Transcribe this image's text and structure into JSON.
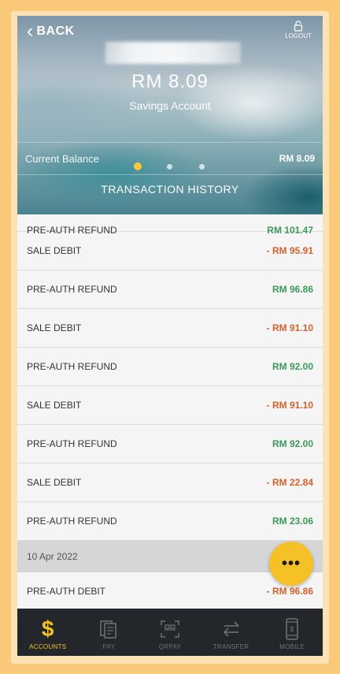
{
  "header": {
    "back_label": "BACK",
    "logout_label": "LOGOUT",
    "balance_display": "RM 8.09",
    "account_type": "Savings Account",
    "current_balance_label": "Current Balance",
    "current_balance_value": "RM 8.09",
    "section_title": "TRANSACTION HISTORY",
    "carousel": {
      "pages": 3,
      "active_index": 0
    }
  },
  "transactions": [
    {
      "desc": "PRE-AUTH REFUND",
      "amount": "RM 101.47",
      "type": "credit",
      "partial": true
    },
    {
      "desc": "SALE DEBIT",
      "amount": "- RM 95.91",
      "type": "debit"
    },
    {
      "desc": "PRE-AUTH REFUND",
      "amount": "RM 96.86",
      "type": "credit"
    },
    {
      "desc": "SALE DEBIT",
      "amount": "- RM 91.10",
      "type": "debit"
    },
    {
      "desc": "PRE-AUTH REFUND",
      "amount": "RM 92.00",
      "type": "credit"
    },
    {
      "desc": "SALE DEBIT",
      "amount": "- RM 91.10",
      "type": "debit"
    },
    {
      "desc": "PRE-AUTH REFUND",
      "amount": "RM 92.00",
      "type": "credit"
    },
    {
      "desc": "SALE DEBIT",
      "amount": "- RM 22.84",
      "type": "debit"
    },
    {
      "desc": "PRE-AUTH REFUND",
      "amount": "RM 23.06",
      "type": "credit"
    }
  ],
  "date_group": {
    "date": "10 Apr 2022",
    "transactions": [
      {
        "desc": "PRE-AUTH DEBIT",
        "amount": "- RM 96.86",
        "type": "debit"
      }
    ]
  },
  "fab": {
    "label": "•••",
    "icon": "more-dots-icon"
  },
  "nav": {
    "items": [
      {
        "label": "ACCOUNTS",
        "icon": "dollar-icon",
        "active": true
      },
      {
        "label": "PAY",
        "icon": "bill-icon",
        "active": false
      },
      {
        "label": "QRPAY",
        "icon": "qr-icon",
        "active": false
      },
      {
        "label": "TRANSFER",
        "icon": "transfer-arrows-icon",
        "active": false
      },
      {
        "label": "MOBILE",
        "icon": "mobile-icon",
        "active": false
      }
    ]
  },
  "colors": {
    "accent": "#f6c126",
    "debit": "#d3622d",
    "credit": "#3a9a59",
    "nav_bg": "#23272b",
    "outer_bg": "#fbc97a"
  }
}
